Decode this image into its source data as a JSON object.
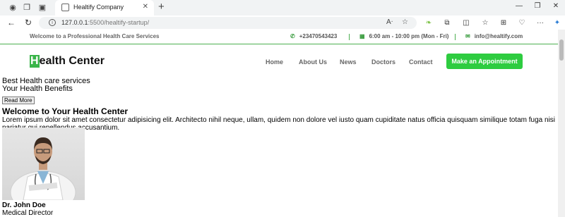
{
  "browser": {
    "tab_title": "Healtify Company",
    "url_host": "127.0.0.1",
    "url_rest": ":5500/healtify-startup/",
    "icons": {
      "profile": "profile-icon",
      "workspaces": "workspaces-icon",
      "tab_actions": "tab-actions-icon",
      "back": "back-arrow-icon",
      "refresh": "refresh-icon",
      "info": "site-info-icon",
      "read_aloud": "read-aloud-icon",
      "favorite": "favorite-star-icon",
      "extension": "leaf-extension-icon",
      "extensions": "puzzle-icon",
      "split": "split-screen-icon",
      "favorites": "favorites-icon",
      "collections": "collections-icon",
      "browser_essentials": "heart-shield-icon",
      "more": "more-icon",
      "copilot": "copilot-icon"
    }
  },
  "topbar": {
    "welcome": "Welcome to a Professional Health Care Services",
    "phone": "+23470543423",
    "hours": "6:00 am - 10:00 pm (Mon - Fri)",
    "email": "info@healtify.com"
  },
  "brand": {
    "first_letter": "H",
    "rest": "ealth Center",
    "accent": "#3ab54a"
  },
  "nav": {
    "items": [
      "Home",
      "About Us",
      "News",
      "Doctors",
      "Contact"
    ],
    "cta": "Make an Appointment",
    "cta_color": "#2ecc40"
  },
  "hero": {
    "line1": "Best Health care services",
    "line2": "Your Health Benefits",
    "button": "Read More"
  },
  "welcome_section": {
    "title": "Welcome to Your Health Center",
    "text": "Lorem ipsum dolor sit amet consectetur adipisicing elit. Architecto nihil neque, ullam, quidem non dolore vel iusto quam cupiditate natus officia quisquam similique totam fuga nisi pariatur qui repellendus accusantium."
  },
  "doctor": {
    "name": "Dr. John Doe",
    "role": "Medical Director"
  }
}
